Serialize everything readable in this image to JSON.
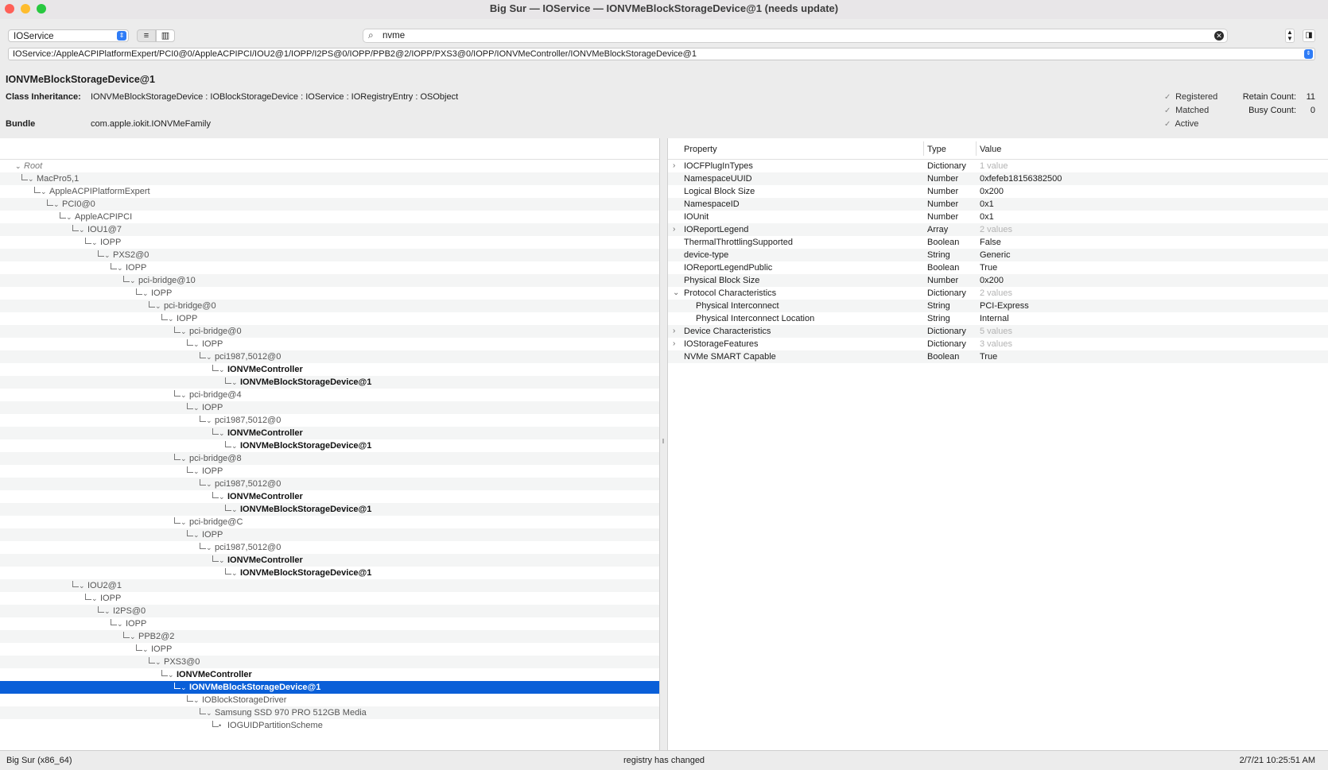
{
  "window": {
    "title": "Big Sur — IOService — IONVMeBlockStorageDevice@1 (needs update)",
    "colors": {
      "close": "#ff5f57",
      "minimize": "#febc2e",
      "zoom": "#28c840",
      "selection": "#0a5fd8"
    }
  },
  "toolbar": {
    "plane_selected": "IOService",
    "list_view_icon": "list-icon",
    "column_view_icon": "columns-icon",
    "search_value": "nvme",
    "path": "IOService:/AppleACPIPlatformExpert/PCI0@0/AppleACPIPCI/IOU2@1/IOPP/I2PS@0/IOPP/PPB2@2/IOPP/PXS3@0/IOPP/IONVMeController/IONVMeBlockStorageDevice@1"
  },
  "info": {
    "name": "IONVMeBlockStorageDevice@1",
    "class_label": "Class Inheritance:",
    "class_value": "IONVMeBlockStorageDevice : IOBlockStorageDevice : IOService : IORegistryEntry : OSObject",
    "bundle_label": "Bundle",
    "bundle_value": "com.apple.iokit.IONVMeFamily",
    "registered": "Registered",
    "matched": "Matched",
    "active": "Active",
    "retain_label": "Retain Count:",
    "retain_value": "11",
    "busy_label": "Busy Count:",
    "busy_value": "0"
  },
  "tree": [
    {
      "label": "Root",
      "depth": 0,
      "style": "root"
    },
    {
      "label": "MacPro5,1",
      "depth": 1,
      "style": "node"
    },
    {
      "label": "AppleACPIPlatformExpert",
      "depth": 2,
      "style": "node"
    },
    {
      "label": "PCI0@0",
      "depth": 3,
      "style": "node"
    },
    {
      "label": "AppleACPIPCI",
      "depth": 4,
      "style": "node"
    },
    {
      "label": "IOU1@7",
      "depth": 5,
      "style": "node"
    },
    {
      "label": "IOPP",
      "depth": 6,
      "style": "node"
    },
    {
      "label": "PXS2@0",
      "depth": 7,
      "style": "node"
    },
    {
      "label": "IOPP",
      "depth": 8,
      "style": "node"
    },
    {
      "label": "pci-bridge@10",
      "depth": 9,
      "style": "node"
    },
    {
      "label": "IOPP",
      "depth": 10,
      "style": "node"
    },
    {
      "label": "pci-bridge@0",
      "depth": 11,
      "style": "node"
    },
    {
      "label": "IOPP",
      "depth": 12,
      "style": "node"
    },
    {
      "label": "pci-bridge@0",
      "depth": 13,
      "style": "node"
    },
    {
      "label": "IOPP",
      "depth": 14,
      "style": "node"
    },
    {
      "label": "pci1987,5012@0",
      "depth": 15,
      "style": "node"
    },
    {
      "label": "IONVMeController",
      "depth": 16,
      "style": "bold"
    },
    {
      "label": "IONVMeBlockStorageDevice@1",
      "depth": 17,
      "style": "bold"
    },
    {
      "label": "pci-bridge@4",
      "depth": 13,
      "style": "node"
    },
    {
      "label": "IOPP",
      "depth": 14,
      "style": "node"
    },
    {
      "label": "pci1987,5012@0",
      "depth": 15,
      "style": "node"
    },
    {
      "label": "IONVMeController",
      "depth": 16,
      "style": "bold"
    },
    {
      "label": "IONVMeBlockStorageDevice@1",
      "depth": 17,
      "style": "bold"
    },
    {
      "label": "pci-bridge@8",
      "depth": 13,
      "style": "node"
    },
    {
      "label": "IOPP",
      "depth": 14,
      "style": "node"
    },
    {
      "label": "pci1987,5012@0",
      "depth": 15,
      "style": "node"
    },
    {
      "label": "IONVMeController",
      "depth": 16,
      "style": "bold"
    },
    {
      "label": "IONVMeBlockStorageDevice@1",
      "depth": 17,
      "style": "bold"
    },
    {
      "label": "pci-bridge@C",
      "depth": 13,
      "style": "node"
    },
    {
      "label": "IOPP",
      "depth": 14,
      "style": "node"
    },
    {
      "label": "pci1987,5012@0",
      "depth": 15,
      "style": "node"
    },
    {
      "label": "IONVMeController",
      "depth": 16,
      "style": "bold"
    },
    {
      "label": "IONVMeBlockStorageDevice@1",
      "depth": 17,
      "style": "bold"
    },
    {
      "label": "IOU2@1",
      "depth": 5,
      "style": "node"
    },
    {
      "label": "IOPP",
      "depth": 6,
      "style": "node"
    },
    {
      "label": "I2PS@0",
      "depth": 7,
      "style": "node"
    },
    {
      "label": "IOPP",
      "depth": 8,
      "style": "node"
    },
    {
      "label": "PPB2@2",
      "depth": 9,
      "style": "node"
    },
    {
      "label": "IOPP",
      "depth": 10,
      "style": "node"
    },
    {
      "label": "PXS3@0",
      "depth": 11,
      "style": "node"
    },
    {
      "label": "IONVMeController",
      "depth": 12,
      "style": "bold"
    },
    {
      "label": "IONVMeBlockStorageDevice@1",
      "depth": 13,
      "style": "bold",
      "selected": true
    },
    {
      "label": "IOBlockStorageDriver",
      "depth": 14,
      "style": "node"
    },
    {
      "label": "Samsung SSD 970 PRO 512GB Media",
      "depth": 15,
      "style": "node"
    },
    {
      "label": "IOGUIDPartitionScheme",
      "depth": 16,
      "style": "node"
    }
  ],
  "props_header": {
    "property": "Property",
    "type": "Type",
    "value": "Value"
  },
  "props": [
    {
      "name": "IOCFPlugInTypes",
      "type": "Dictionary",
      "value": "1 value",
      "expand": "closed",
      "muted": true,
      "indent": 0
    },
    {
      "name": "NamespaceUUID",
      "type": "Number",
      "value": "0xfefeb18156382500",
      "indent": 0
    },
    {
      "name": "Logical Block Size",
      "type": "Number",
      "value": "0x200",
      "indent": 0
    },
    {
      "name": "NamespaceID",
      "type": "Number",
      "value": "0x1",
      "indent": 0
    },
    {
      "name": "IOUnit",
      "type": "Number",
      "value": "0x1",
      "indent": 0
    },
    {
      "name": "IOReportLegend",
      "type": "Array",
      "value": "2 values",
      "expand": "closed",
      "muted": true,
      "indent": 0
    },
    {
      "name": "ThermalThrottlingSupported",
      "type": "Boolean",
      "value": "False",
      "indent": 0
    },
    {
      "name": "device-type",
      "type": "String",
      "value": "Generic",
      "indent": 0
    },
    {
      "name": "IOReportLegendPublic",
      "type": "Boolean",
      "value": "True",
      "indent": 0
    },
    {
      "name": "Physical Block Size",
      "type": "Number",
      "value": "0x200",
      "indent": 0
    },
    {
      "name": "Protocol Characteristics",
      "type": "Dictionary",
      "value": "2 values",
      "expand": "open",
      "muted": true,
      "indent": 0
    },
    {
      "name": "Physical Interconnect",
      "type": "String",
      "value": "PCI-Express",
      "indent": 1
    },
    {
      "name": "Physical Interconnect Location",
      "type": "String",
      "value": "Internal",
      "indent": 1
    },
    {
      "name": "Device Characteristics",
      "type": "Dictionary",
      "value": "5 values",
      "expand": "closed",
      "muted": true,
      "indent": 0
    },
    {
      "name": "IOStorageFeatures",
      "type": "Dictionary",
      "value": "3 values",
      "expand": "closed",
      "muted": true,
      "indent": 0
    },
    {
      "name": "NVMe SMART Capable",
      "type": "Boolean",
      "value": "True",
      "indent": 0
    }
  ],
  "status": {
    "left": "Big Sur (x86_64)",
    "center": "registry has changed",
    "right": "2/7/21 10:25:51 AM"
  }
}
